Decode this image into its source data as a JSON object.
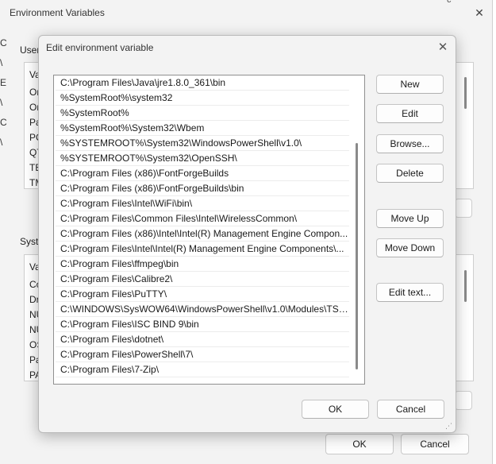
{
  "background_window": {
    "title": "Environment Variables",
    "user_section_fragment": "User",
    "system_section_fragment": "Syste",
    "user_list_fragments": [
      "Va",
      "Or",
      "Or",
      "Pa",
      "PC",
      "QT",
      "TE",
      "TM"
    ],
    "system_list_fragments": [
      "Va",
      "Co",
      "Dr",
      "NU",
      "NU",
      "OS",
      "Pa",
      "PA"
    ],
    "left_edge_fragments": [
      "C",
      "\\",
      "E",
      "\\",
      "C",
      "\\"
    ],
    "ok_label": "OK",
    "cancel_label": "Cancel"
  },
  "dialog": {
    "title": "Edit environment variable",
    "entries": [
      "C:\\Program Files\\Java\\jre1.8.0_361\\bin",
      "%SystemRoot%\\system32",
      "%SystemRoot%",
      "%SystemRoot%\\System32\\Wbem",
      "%SYSTEMROOT%\\System32\\WindowsPowerShell\\v1.0\\",
      "%SYSTEMROOT%\\System32\\OpenSSH\\",
      "C:\\Program Files (x86)\\FontForgeBuilds",
      "C:\\Program Files (x86)\\FontForgeBuilds\\bin",
      "C:\\Program Files\\Intel\\WiFi\\bin\\",
      "C:\\Program Files\\Common Files\\Intel\\WirelessCommon\\",
      "C:\\Program Files (x86)\\Intel\\Intel(R) Management Engine Compon...",
      "C:\\Program Files\\Intel\\Intel(R) Management Engine Components\\...",
      "C:\\Program Files\\ffmpeg\\bin",
      "C:\\Program Files\\Calibre2\\",
      "C:\\Program Files\\PuTTY\\",
      "C:\\WINDOWS\\SysWOW64\\WindowsPowerShell\\v1.0\\Modules\\TSh...",
      "C:\\Program Files\\ISC BIND 9\\bin",
      "C:\\Program Files\\dotnet\\",
      "C:\\Program Files\\PowerShell\\7\\",
      "C:\\Program Files\\7-Zip\\"
    ],
    "buttons": {
      "new": "New",
      "edit": "Edit",
      "browse": "Browse...",
      "delete": "Delete",
      "move_up": "Move Up",
      "move_down": "Move Down",
      "edit_text": "Edit text..."
    },
    "ok_label": "OK",
    "cancel_label": "Cancel"
  },
  "icons": {
    "close": "close-icon",
    "resize_grip": "resize-grip-icon"
  }
}
